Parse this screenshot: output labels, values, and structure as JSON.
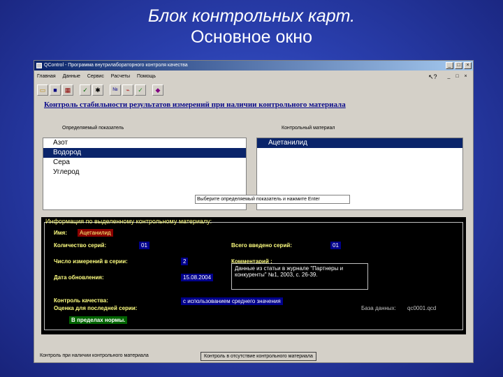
{
  "slide": {
    "title_line1": "Блок контрольных карт.",
    "title_line2": "Основное окно"
  },
  "window": {
    "title": "QControl - Программа внутрилабораторного контроля качества",
    "buttons": [
      "_",
      "□",
      "×"
    ],
    "mdi_buttons": [
      "_",
      "□",
      "×"
    ],
    "menu": [
      "Главная",
      "Данные",
      "Сервис",
      "Расчеты",
      "Помощь"
    ],
    "toolbar_icons": [
      "open-folder-icon",
      "save-icon",
      "calculator-icon",
      "check-icon",
      "settings-icon",
      "numbers-icon",
      "chart-icon",
      "chart-check-icon",
      "book-icon"
    ],
    "toolbar_glyphs": [
      "▭",
      "■",
      "▦",
      "✓",
      "✱",
      "№",
      "⌁",
      "✓",
      "◆"
    ]
  },
  "main": {
    "heading": "Контроль стабильности результатов измерений при наличии контрольного материала",
    "left_label": "Определяемый показатель",
    "right_label": "Контрольный материал",
    "indicators": [
      "Азот",
      "Водород",
      "Сера",
      "Углерод"
    ],
    "selected_indicator": 1,
    "materials": [
      "Ацетанилид"
    ],
    "selected_material": 0,
    "hint": "Выберите определяемый показатель и нажмите Enter"
  },
  "info": {
    "title": "Информация по выделенному контрольному материалу:",
    "name_label": "Имя:",
    "name_value": "Ацетанилид",
    "series_count_label": "Количество серий:",
    "series_count_value": "01",
    "total_series_label": "Всего введено серий:",
    "total_series_value": "01",
    "measurements_label": "Число измерений в серии:",
    "measurements_value": "2",
    "comment_label": "Комментарий :",
    "comment_value": "Данные из статьи в журнале \"Партнеры и конкуренты\" №1, 2003, с. 26-39.",
    "update_date_label": "Дата обновления:",
    "update_date_value": "15.08.2004",
    "quality_label": "Контроль качества:",
    "quality_value": "с использованием среднего значения",
    "last_series_label": "Оценка для последней серии:",
    "last_series_value": "В пределах нормы.",
    "database_label": "База данных:",
    "database_value": "qc0001.qcd"
  },
  "statusbar": {
    "tab1": "Контроль при наличии контрольного материала",
    "tab2": "Контроль в отсутствие контрольного материала"
  }
}
